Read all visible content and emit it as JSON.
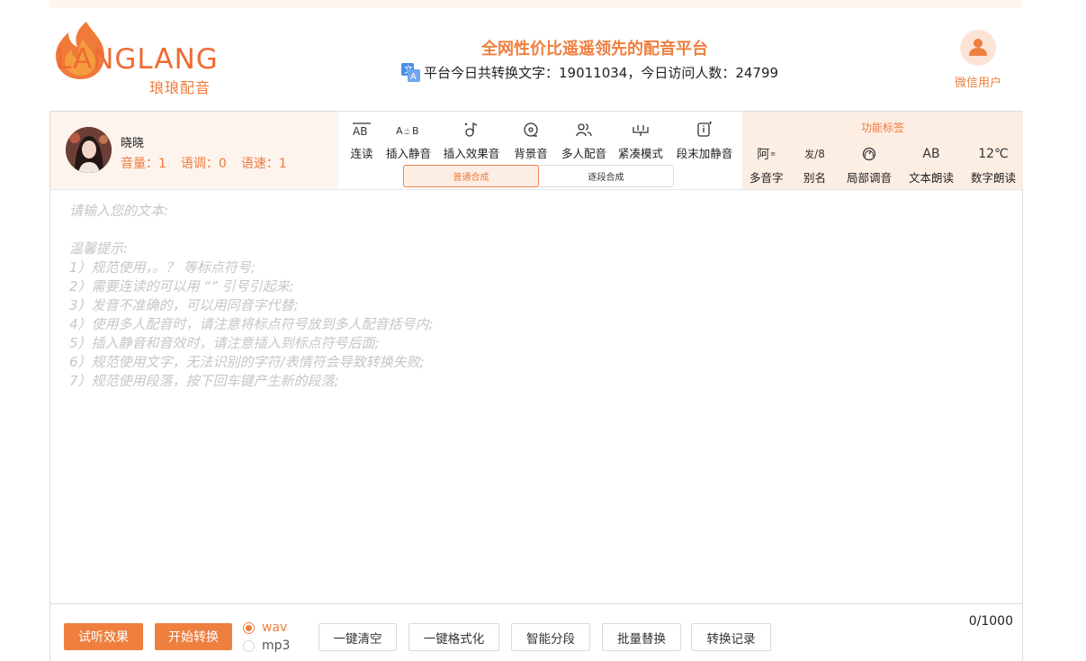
{
  "brand": {
    "logo_text": "LANGLANG",
    "logo_sub": "琅琅配音"
  },
  "header": {
    "title": "全网性价比遥遥领先的配音平台",
    "stats_text": "平台今日共转换文字：19011034，今日访问人数：24799"
  },
  "user": {
    "label": "微信用户",
    "icon": "user-icon"
  },
  "voice": {
    "name": "晓晓",
    "volume": "音量：1",
    "pitch": "语调：0",
    "speed": "语速：1"
  },
  "tools": [
    {
      "label": "连读",
      "icon": "liaison-icon"
    },
    {
      "label": "插入静音",
      "icon": "insert-silence-icon"
    },
    {
      "label": "插入效果音",
      "icon": "sound-effect-icon"
    },
    {
      "label": "背景音",
      "icon": "background-music-icon"
    },
    {
      "label": "多人配音",
      "icon": "multi-voice-icon"
    },
    {
      "label": "紧凑模式",
      "icon": "compact-mode-icon"
    },
    {
      "label": "段末加静音",
      "icon": "paragraph-silence-icon"
    }
  ],
  "modes": {
    "normal": "普通合成",
    "segmented": "逐段合成",
    "active": "normal"
  },
  "features": {
    "title": "功能标签",
    "items": [
      {
        "label": "多音字",
        "glyph": "阿",
        "icon": "polyphone-icon"
      },
      {
        "label": "别名",
        "glyph": "发",
        "icon": "alias-icon"
      },
      {
        "label": "局部调音",
        "icon": "tuning-icon"
      },
      {
        "label": "文本朗读",
        "glyph": "AB",
        "icon": "text-read-icon"
      },
      {
        "label": "数字朗读",
        "glyph": "12℃",
        "icon": "number-read-icon"
      }
    ]
  },
  "editor": {
    "placeholder": "请输入您的文本:\n\n温馨提示:\n1）规范使用，。？ 等标点符号;\n2）需要连读的可以用 “” 引号引起来;\n3）发音不准确的，可以用同音字代替;\n4）使用多人配音时，请注意将标点符号放到多人配音括号内;\n5）插入静音和音效时，请注意插入到标点符号后面;\n6）规范使用文字，无法识别的字符/表情符会导致转换失败;\n7）规范使用段落，按下回车键产生新的段落;"
  },
  "actions": {
    "preview": "试听效果",
    "convert": "开始转换",
    "format_wav": "wav",
    "format_mp3": "mp3",
    "selected_format": "wav",
    "clear": "一键清空",
    "format_text": "一键格式化",
    "smart_split": "智能分段",
    "batch_replace": "批量替换",
    "history": "转换记录",
    "counter": "0/1000"
  },
  "colors": {
    "accent": "#ef7f3f",
    "accent_light": "#fdeee4"
  }
}
